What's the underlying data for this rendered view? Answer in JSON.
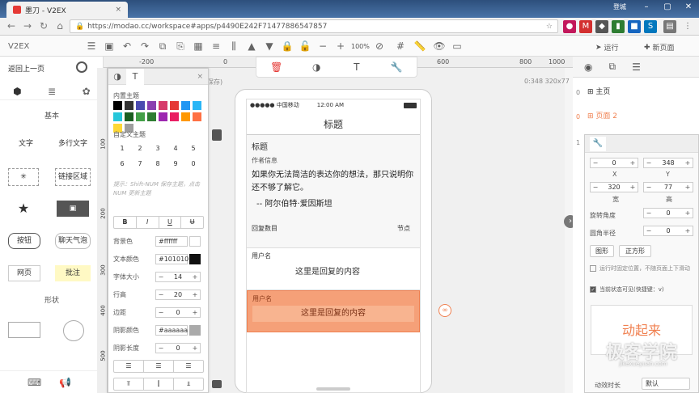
{
  "browser": {
    "tab_title": "墨刀 - V2EX",
    "tab_close": "×",
    "win_label": "登城",
    "url": "https://modao.cc/workspace#apps/p4490E242F71477886547857"
  },
  "app": {
    "logo": "V2EX",
    "zoom": "100%",
    "run_label": "运行",
    "new_page_label": "新页面"
  },
  "ruler": {
    "t1": "-200",
    "t2": "0",
    "t3": "200",
    "t4": "400",
    "t5": "600",
    "t6": "800",
    "t7": "1000",
    "l1": "100",
    "l2": "200",
    "l3": "300",
    "l4": "400",
    "l5": "500",
    "coords": "0:348 320x77",
    "save_state": "保存)"
  },
  "library": {
    "back": "返回上一页",
    "section_basic": "基本",
    "text": "文字",
    "multiline": "多行文字",
    "link_area": "链接区域",
    "button": "按钮",
    "bubble": "聊天气泡",
    "web": "网页",
    "note": "批注",
    "section_shape": "形状"
  },
  "style_panel": {
    "builtin_theme": "内置主题",
    "custom_theme": "自定义主题",
    "num_keys": [
      "1",
      "2",
      "3",
      "4",
      "5",
      "6",
      "7",
      "8",
      "9",
      "0"
    ],
    "hint": "提示：Shift-NUM 保存主题，点击 NUM 更新主题",
    "bold": "B",
    "italic": "I",
    "underline": "U",
    "strike": "U",
    "bg_label": "背景色",
    "bg_value": "#ffffff",
    "text_color_label": "文本颜色",
    "text_color_value": "#101010",
    "font_size_label": "字体大小",
    "font_size_value": "14",
    "line_height_label": "行高",
    "line_height_value": "20",
    "border_label": "边距",
    "border_value": "0",
    "shadow_color_label": "阴影颜色",
    "shadow_color_value": "#aaaaaa",
    "shadow_len_label": "阴影长度",
    "shadow_len_value": "0",
    "theme_colors": [
      "#000000",
      "#333333",
      "#4b4bb0",
      "#8a3fb0",
      "#d63a6b",
      "#e53935",
      "#2196f3",
      "#29b6f6",
      "#26c6da",
      "#1b5e20",
      "#43a047",
      "#2e7d32",
      "#9c27b0",
      "#e91e63",
      "#ff9800",
      "#ff7043",
      "#fdd835",
      "#9e9e9e"
    ]
  },
  "phone": {
    "carrier": "●●●●● 中国移动",
    "time": "12:00 AM",
    "nav_title": "标题",
    "topic_title": "标题",
    "author": "作者信息",
    "quote": "如果你无法简洁的表达你的想法，那只说明你还不够了解它。",
    "quote_author": "-- 阿尔伯特·爱因斯坦",
    "reply_count": "回复数目",
    "node": "节点",
    "reply1_user": "用户名",
    "reply1_content": "这里是回复的内容",
    "reply2_user": "用户名",
    "reply2_content": "这里是回复的内容"
  },
  "pages": {
    "home": "主页",
    "page2": "页面 2",
    "idx0": "0",
    "idx1": "1"
  },
  "inspector": {
    "x_value": "0",
    "y_value": "348",
    "x_label": "X",
    "y_label": "Y",
    "w_value": "320",
    "h_value": "77",
    "w_label": "宽",
    "h_label": "高",
    "rotate_label": "旋转角度",
    "rotate_value": "0",
    "radius_label": "圆角半径",
    "radius_value": "0",
    "btn_shape": "图形",
    "btn_square": "正方形",
    "check1": "运行时固定位置，不随页面上下滑动",
    "check2": "当前状态可见(快捷键：v)",
    "anim": "动起来",
    "anim_label": "动效时长",
    "anim_select": "默认"
  },
  "watermark": {
    "main": "极客学院",
    "sub": "jikexueyuan.com"
  }
}
